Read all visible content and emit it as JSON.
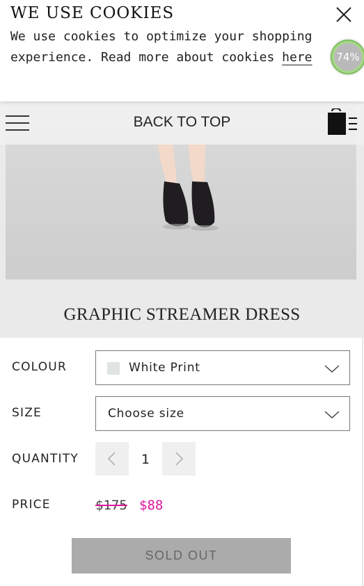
{
  "cookie_banner": {
    "title": "WE USE COOKIES",
    "text": "We use cookies to optimize your shopping experience. Read more about cookies ",
    "link_label": "here",
    "close_icon": "close-icon"
  },
  "progress_badge": {
    "value_label": "74%",
    "value": 74
  },
  "nav": {
    "menu_icon": "hamburger-icon",
    "back_to_top_label": "BACK TO TOP",
    "bag_icon": "shopping-bag-icon"
  },
  "product": {
    "title": "GRAPHIC STREAMER DRESS",
    "colour": {
      "label": "COLOUR",
      "selected": "White Print",
      "swatch_color": "#dfe4e3"
    },
    "size": {
      "label": "SIZE",
      "placeholder": "Choose size"
    },
    "quantity": {
      "label": "QUANTITY",
      "value": "1"
    },
    "price": {
      "label": "PRICE",
      "original": "$175",
      "sale": "$88",
      "sale_color": "#e0189b"
    },
    "button_label": "SOLD OUT"
  }
}
